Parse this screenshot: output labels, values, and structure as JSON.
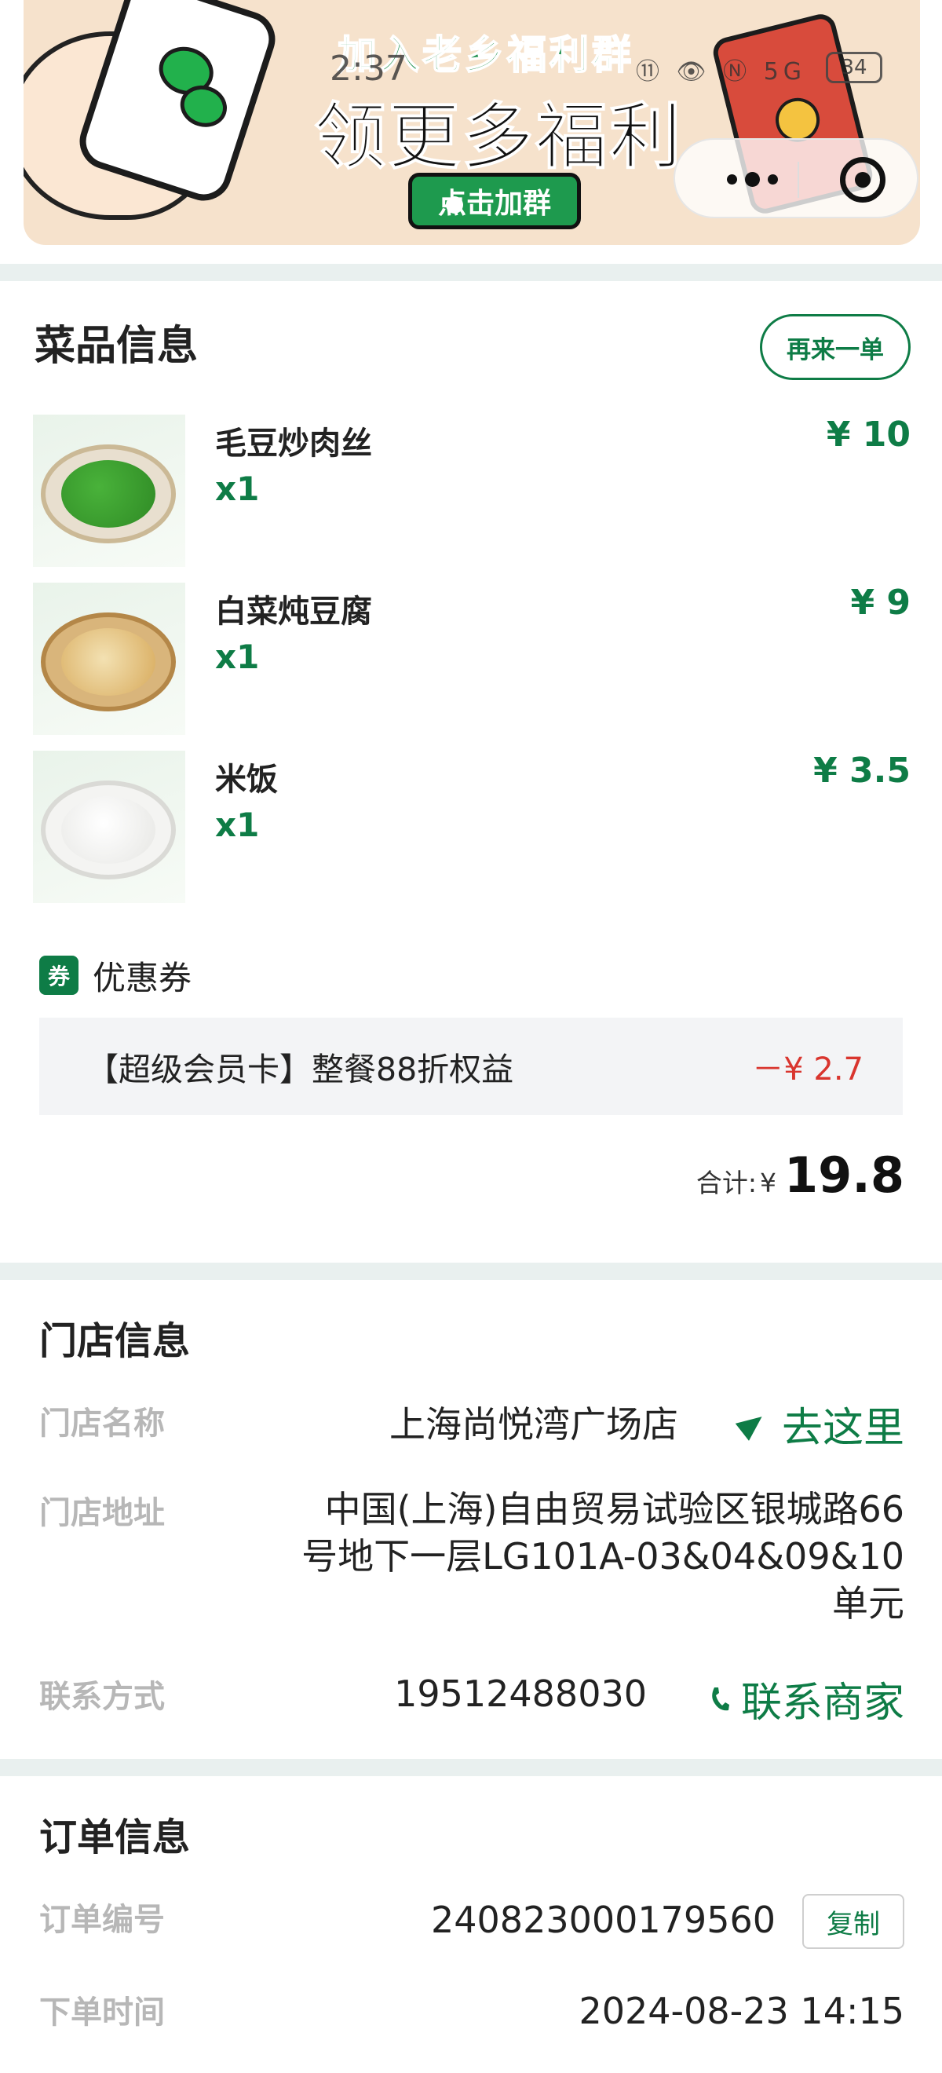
{
  "banner": {
    "headline_small": "加入老乡福利群",
    "headline_big": "领更多福利",
    "join_button": "点击加群",
    "status_time": "2:37",
    "status_icons": "⑪ 👁 Ⓝ 5G",
    "battery": "34"
  },
  "dishes": {
    "title": "菜品信息",
    "reorder_label": "再来一单",
    "items": [
      {
        "name": "毛豆炒肉丝",
        "qty": "x1",
        "price": "¥ 10"
      },
      {
        "name": "白菜炖豆腐",
        "qty": "x1",
        "price": "¥ 9"
      },
      {
        "name": "米饭",
        "qty": "x1",
        "price": "¥ 3.5"
      }
    ],
    "coupon_tag": "券",
    "coupon_label": "优惠券",
    "coupon_name": "【超级会员卡】整餐88折权益",
    "coupon_discount": "－¥ 2.7",
    "total_label": "合计:",
    "total_currency": "¥",
    "total_amount": "19.8"
  },
  "store": {
    "title": "门店信息",
    "name_label": "门店名称",
    "name_value": "上海尚悦湾广场店",
    "navigate_label": "去这里",
    "address_label": "门店地址",
    "address_lines": [
      "中国(上海)自由贸易试验区银城路66",
      "号地下一层LG101A-03&04&09&10",
      "单元"
    ],
    "contact_label": "联系方式",
    "contact_value": "19512488030",
    "contact_link": "联系商家"
  },
  "order": {
    "title": "订单信息",
    "number_label": "订单编号",
    "number_value": "240823000179560",
    "copy_label": "复制",
    "time_label": "下单时间",
    "time_value": "2024-08-23 14:15"
  },
  "colors": {
    "accent_green": "#0e7c46",
    "discount_red": "#d9352e",
    "section_gap": "#e9f0ef"
  }
}
